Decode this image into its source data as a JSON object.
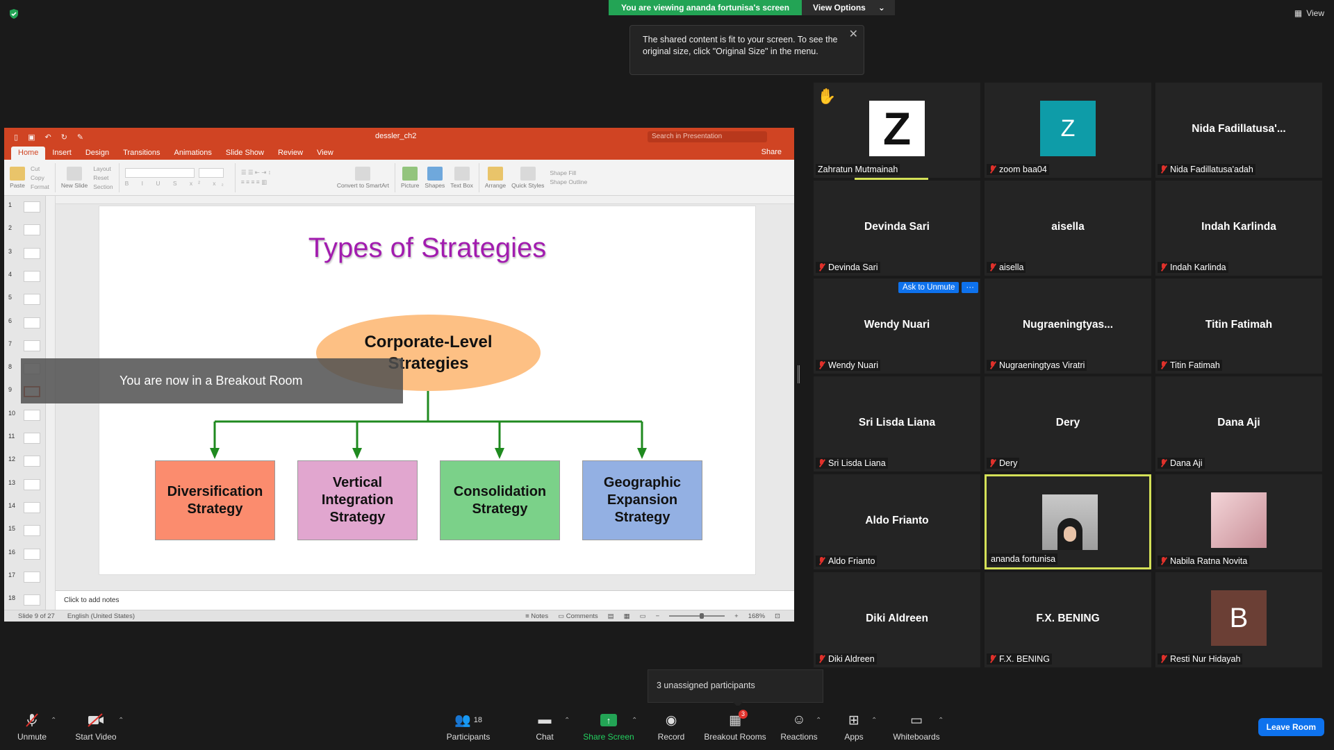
{
  "top": {
    "viewing_text": "You are viewing ananda fortunisa's screen",
    "view_options": "View Options",
    "view_button": "View",
    "tooltip_text": "The shared content is fit to your screen. To see the original size, click \"Original Size\" in the menu."
  },
  "ppt": {
    "doc_title": "dessler_ch2",
    "search_placeholder": "Search in Presentation",
    "share": "Share",
    "tabs": [
      "Home",
      "Insert",
      "Design",
      "Transitions",
      "Animations",
      "Slide Show",
      "Review",
      "View"
    ],
    "ribbon": {
      "paste": "Paste",
      "cut": "Cut",
      "copy": "Copy",
      "format": "Format",
      "new_slide": "New Slide",
      "layout": "Layout",
      "reset": "Reset",
      "section": "Section",
      "convert": "Convert to SmartArt",
      "picture": "Picture",
      "shapes": "Shapes",
      "text_box": "Text Box",
      "arrange": "Arrange",
      "quick_styles": "Quick Styles",
      "shape_fill": "Shape Fill",
      "shape_outline": "Shape Outline"
    },
    "thumb_numbers": [
      "1",
      "2",
      "3",
      "4",
      "5",
      "6",
      "7",
      "8",
      "9",
      "10",
      "11",
      "12",
      "13",
      "14",
      "15",
      "16",
      "17",
      "18"
    ],
    "active_slide": "9",
    "slide": {
      "title": "Types of Strategies",
      "root_line1": "Corporate-Level",
      "root_line2": "Strategies",
      "boxes": [
        {
          "l1": "Diversification",
          "l2": "Strategy",
          "l3": ""
        },
        {
          "l1": "Vertical",
          "l2": "Integration",
          "l3": "Strategy"
        },
        {
          "l1": "Consolidation",
          "l2": "Strategy",
          "l3": ""
        },
        {
          "l1": "Geographic",
          "l2": "Expansion",
          "l3": "Strategy"
        }
      ]
    },
    "notes_placeholder": "Click to add notes",
    "status": {
      "slide_of": "Slide 9 of 27",
      "language": "English (United States)",
      "notes": "Notes",
      "comments": "Comments",
      "zoom": "168%"
    }
  },
  "breakout_toast": "You are now in a Breakout Room",
  "participants": [
    {
      "name": "Zahratun Mutmainah",
      "center": "",
      "muted": false
    },
    {
      "name": "zoom baa04",
      "center": "",
      "muted": true
    },
    {
      "name": "Nida Fadillatusa'adah",
      "center": "Nida  Fadillatusa'...",
      "muted": true
    },
    {
      "name": "Devinda Sari",
      "center": "Devinda Sari",
      "muted": true
    },
    {
      "name": "aisella",
      "center": "aisella",
      "muted": true
    },
    {
      "name": "Indah Karlinda",
      "center": "Indah Karlinda",
      "muted": true
    },
    {
      "name": "Wendy Nuari",
      "center": "Wendy Nuari",
      "muted": true
    },
    {
      "name": "Nugraeningtyas Viratri",
      "center": "Nugraeningtyas...",
      "muted": true
    },
    {
      "name": "Titin Fatimah",
      "center": "Titin Fatimah",
      "muted": true
    },
    {
      "name": "Sri Lisda Liana",
      "center": "Sri Lisda Liana",
      "muted": true
    },
    {
      "name": "Dery",
      "center": "Dery",
      "muted": true
    },
    {
      "name": "Dana Aji",
      "center": "Dana Aji",
      "muted": true
    },
    {
      "name": "Aldo Frianto",
      "center": "Aldo Frianto",
      "muted": true
    },
    {
      "name": "ananda fortunisa",
      "center": "",
      "muted": false
    },
    {
      "name": "Nabila Ratna Novita",
      "center": "",
      "muted": true
    },
    {
      "name": "Diki Aldreen",
      "center": "Diki Aldreen",
      "muted": true
    },
    {
      "name": "F.X. BENING",
      "center": "F.X. BENING",
      "muted": true
    },
    {
      "name": "Resti Nur Hidayah",
      "center": "",
      "muted": true
    }
  ],
  "avatars": {
    "zoom_letter": "Z",
    "resti_letter": "B",
    "zahratun_letter": "Z"
  },
  "ask_unmute": "Ask to Unmute",
  "more": "···",
  "unassigned": "3 unassigned participants",
  "toolbar": {
    "unmute": "Unmute",
    "start_video": "Start Video",
    "participants": "Participants",
    "participants_count": "18",
    "chat": "Chat",
    "share_screen": "Share Screen",
    "record": "Record",
    "breakout_rooms": "Breakout Rooms",
    "breakout_badge": "3",
    "reactions": "Reactions",
    "apps": "Apps",
    "whiteboards": "Whiteboards",
    "leave": "Leave Room"
  }
}
